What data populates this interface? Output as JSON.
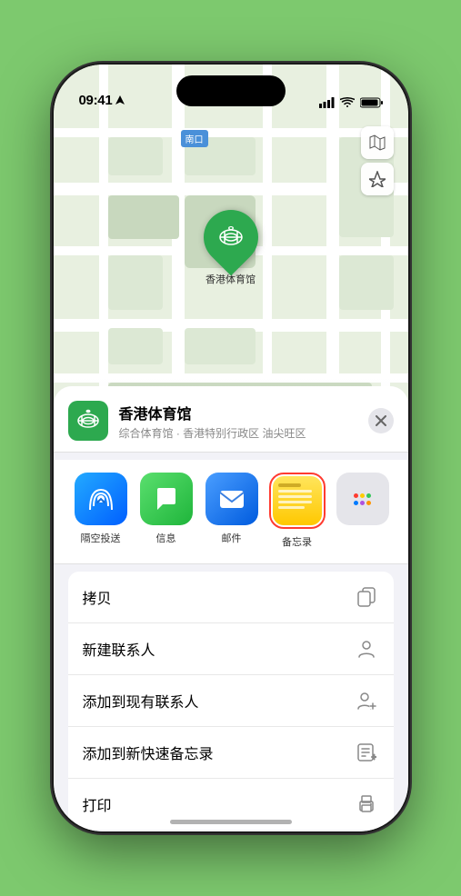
{
  "status_bar": {
    "time": "09:41",
    "location_arrow": true
  },
  "map": {
    "label_text": "南口",
    "pin_label": "香港体育馆",
    "controls": {
      "map_icon": "🗺",
      "location_icon": "⬆"
    }
  },
  "bottom_sheet": {
    "venue_name": "香港体育馆",
    "venue_subtitle": "综合体育馆 · 香港特别行政区 油尖旺区",
    "close_label": "×",
    "share_items": [
      {
        "id": "airdrop",
        "label": "隔空投送"
      },
      {
        "id": "messages",
        "label": "信息"
      },
      {
        "id": "mail",
        "label": "邮件"
      },
      {
        "id": "notes",
        "label": "备忘录",
        "selected": true
      }
    ],
    "actions": [
      {
        "id": "copy",
        "label": "拷贝",
        "icon": "copy"
      },
      {
        "id": "new-contact",
        "label": "新建联系人",
        "icon": "person"
      },
      {
        "id": "add-contact",
        "label": "添加到现有联系人",
        "icon": "person-add"
      },
      {
        "id": "quick-note",
        "label": "添加到新快速备忘录",
        "icon": "note"
      },
      {
        "id": "print",
        "label": "打印",
        "icon": "print"
      }
    ]
  }
}
